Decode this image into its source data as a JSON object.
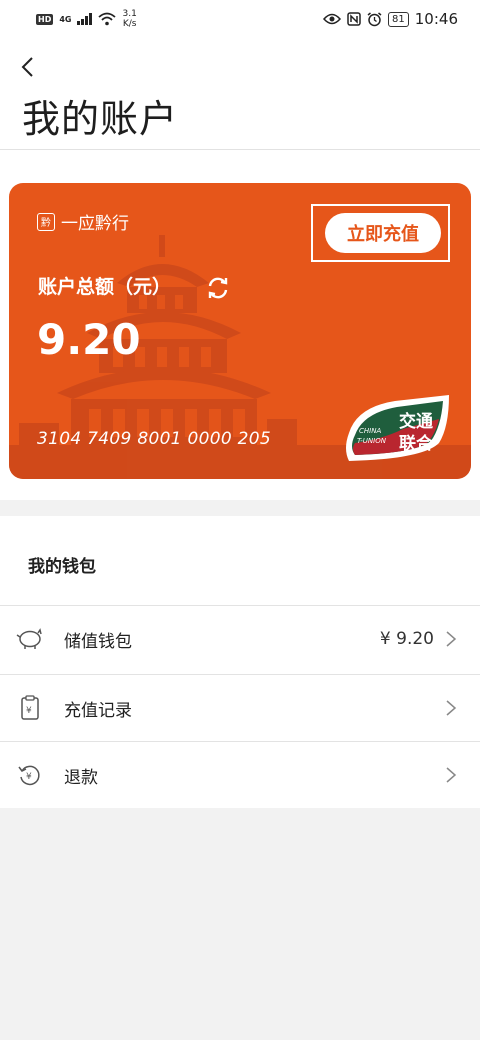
{
  "status_bar": {
    "hd": "HD",
    "network": "4G",
    "speed_value": "3.1",
    "speed_unit": "K/s",
    "battery": "81",
    "time": "10:46"
  },
  "header": {
    "title": "我的账户"
  },
  "card": {
    "brand": "一应黔行",
    "topup_label": "立即充值",
    "balance_label": "账户总额（元）",
    "balance_value": "9.20",
    "card_number": "3104 7409 8001 0000 205",
    "tunion_cn": "交通联合",
    "tunion_en": "CHINA T-UNION",
    "colors": {
      "card": "#e6561a",
      "tunion_green": "#1f5e3d",
      "tunion_red": "#b9262f"
    }
  },
  "wallet": {
    "title": "我的钱包",
    "rows": [
      {
        "icon": "piggy-bank-icon",
        "label": "储值钱包",
        "value": "¥ 9.20"
      },
      {
        "icon": "receipt-icon",
        "label": "充值记录",
        "value": ""
      },
      {
        "icon": "refund-icon",
        "label": "退款",
        "value": ""
      }
    ]
  }
}
